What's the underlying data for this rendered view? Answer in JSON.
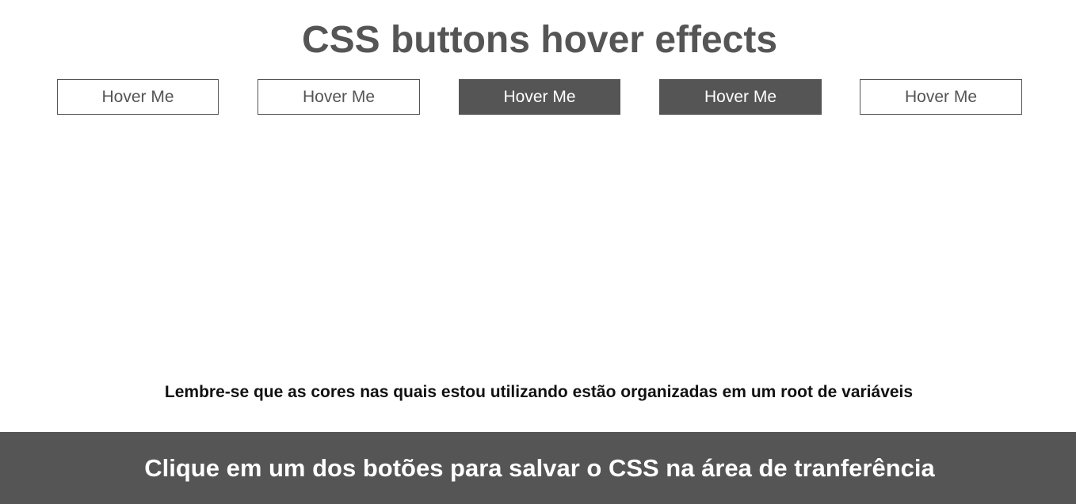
{
  "header": {
    "title": "CSS buttons hover effects"
  },
  "buttons": [
    {
      "label": "Hover Me",
      "style": "outline"
    },
    {
      "label": "Hover Me",
      "style": "outline"
    },
    {
      "label": "Hover Me",
      "style": "filled"
    },
    {
      "label": "Hover Me",
      "style": "filled"
    },
    {
      "label": "Hover Me",
      "style": "outline"
    }
  ],
  "note": {
    "text": "Lembre-se que as cores nas quais estou utilizando estão organizadas em um root de variáveis"
  },
  "footer": {
    "text": "Clique em um dos botões para salvar o CSS na área de tranferência"
  },
  "colors": {
    "primary": "#555555",
    "background": "#ffffff",
    "text_dark": "#111111"
  }
}
